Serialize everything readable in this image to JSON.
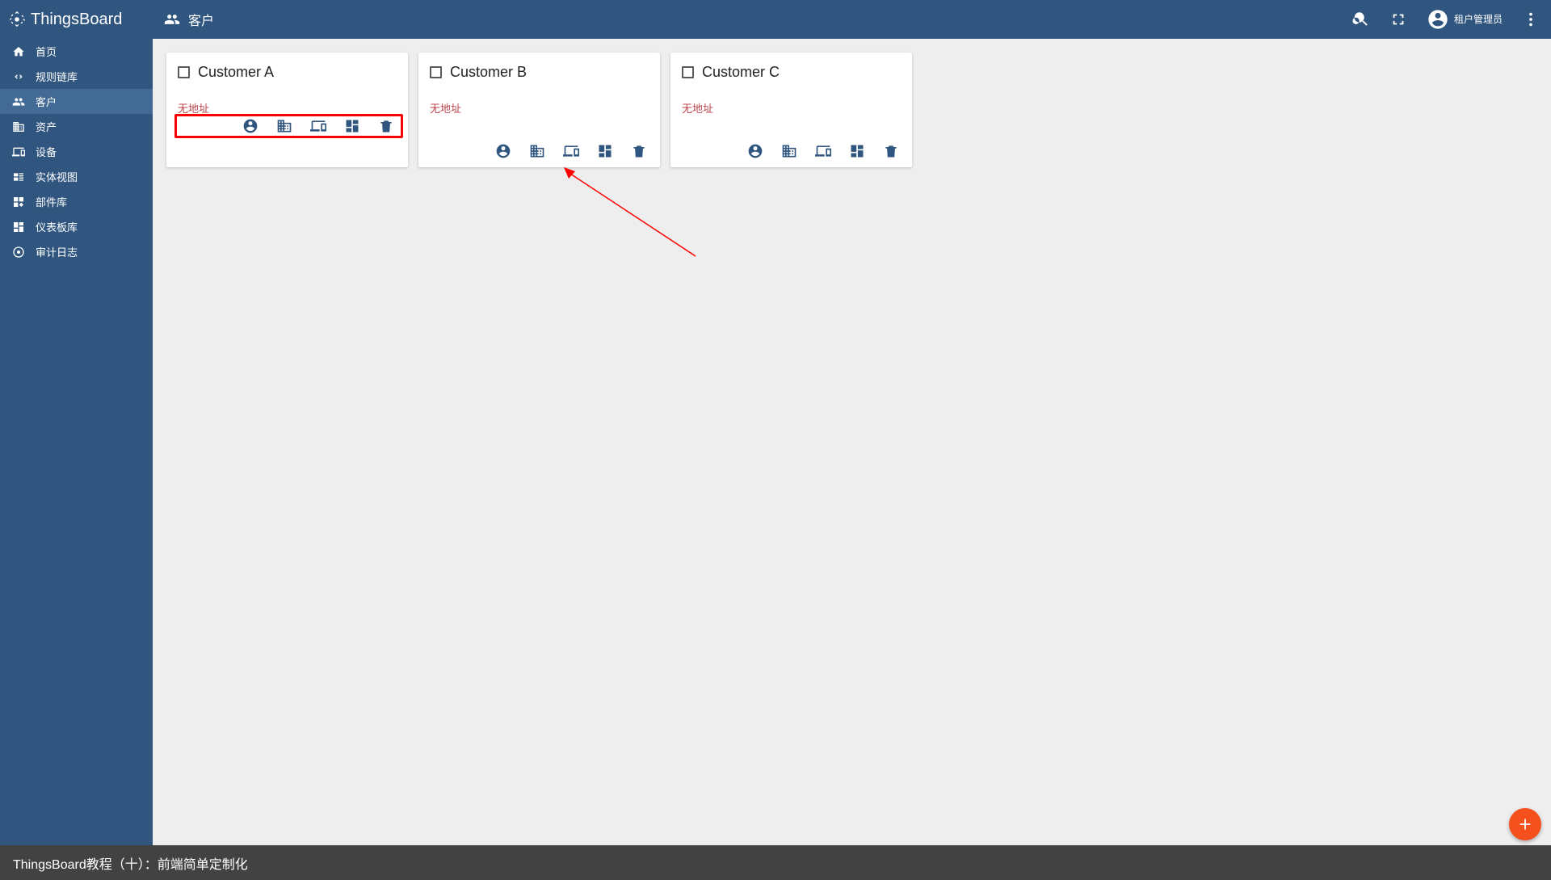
{
  "brand": "ThingsBoard",
  "page_title": "客户",
  "sidebar": {
    "items": [
      {
        "label": "首页",
        "icon": "home"
      },
      {
        "label": "规则链库",
        "icon": "code"
      },
      {
        "label": "客户",
        "icon": "group",
        "active": true
      },
      {
        "label": "资产",
        "icon": "domain"
      },
      {
        "label": "设备",
        "icon": "devices"
      },
      {
        "label": "实体视图",
        "icon": "viewq"
      },
      {
        "label": "部件库",
        "icon": "widgets"
      },
      {
        "label": "仪表板库",
        "icon": "dash"
      },
      {
        "label": "审计日志",
        "icon": "track"
      }
    ]
  },
  "user_role": "租户管理员",
  "customers": [
    {
      "name": "Customer A",
      "sub": "无地址",
      "highlight": true
    },
    {
      "name": "Customer B",
      "sub": "无地址",
      "highlight": false
    },
    {
      "name": "Customer C",
      "sub": "无地址",
      "highlight": false
    }
  ],
  "card_action_icons": [
    "account",
    "domain",
    "devices",
    "dash",
    "delete"
  ],
  "footer_text": "ThingsBoard教程（十）：前端简单定制化",
  "colors": {
    "primary": "#305680",
    "accent": "#f4511e",
    "error": "#b9464b"
  }
}
